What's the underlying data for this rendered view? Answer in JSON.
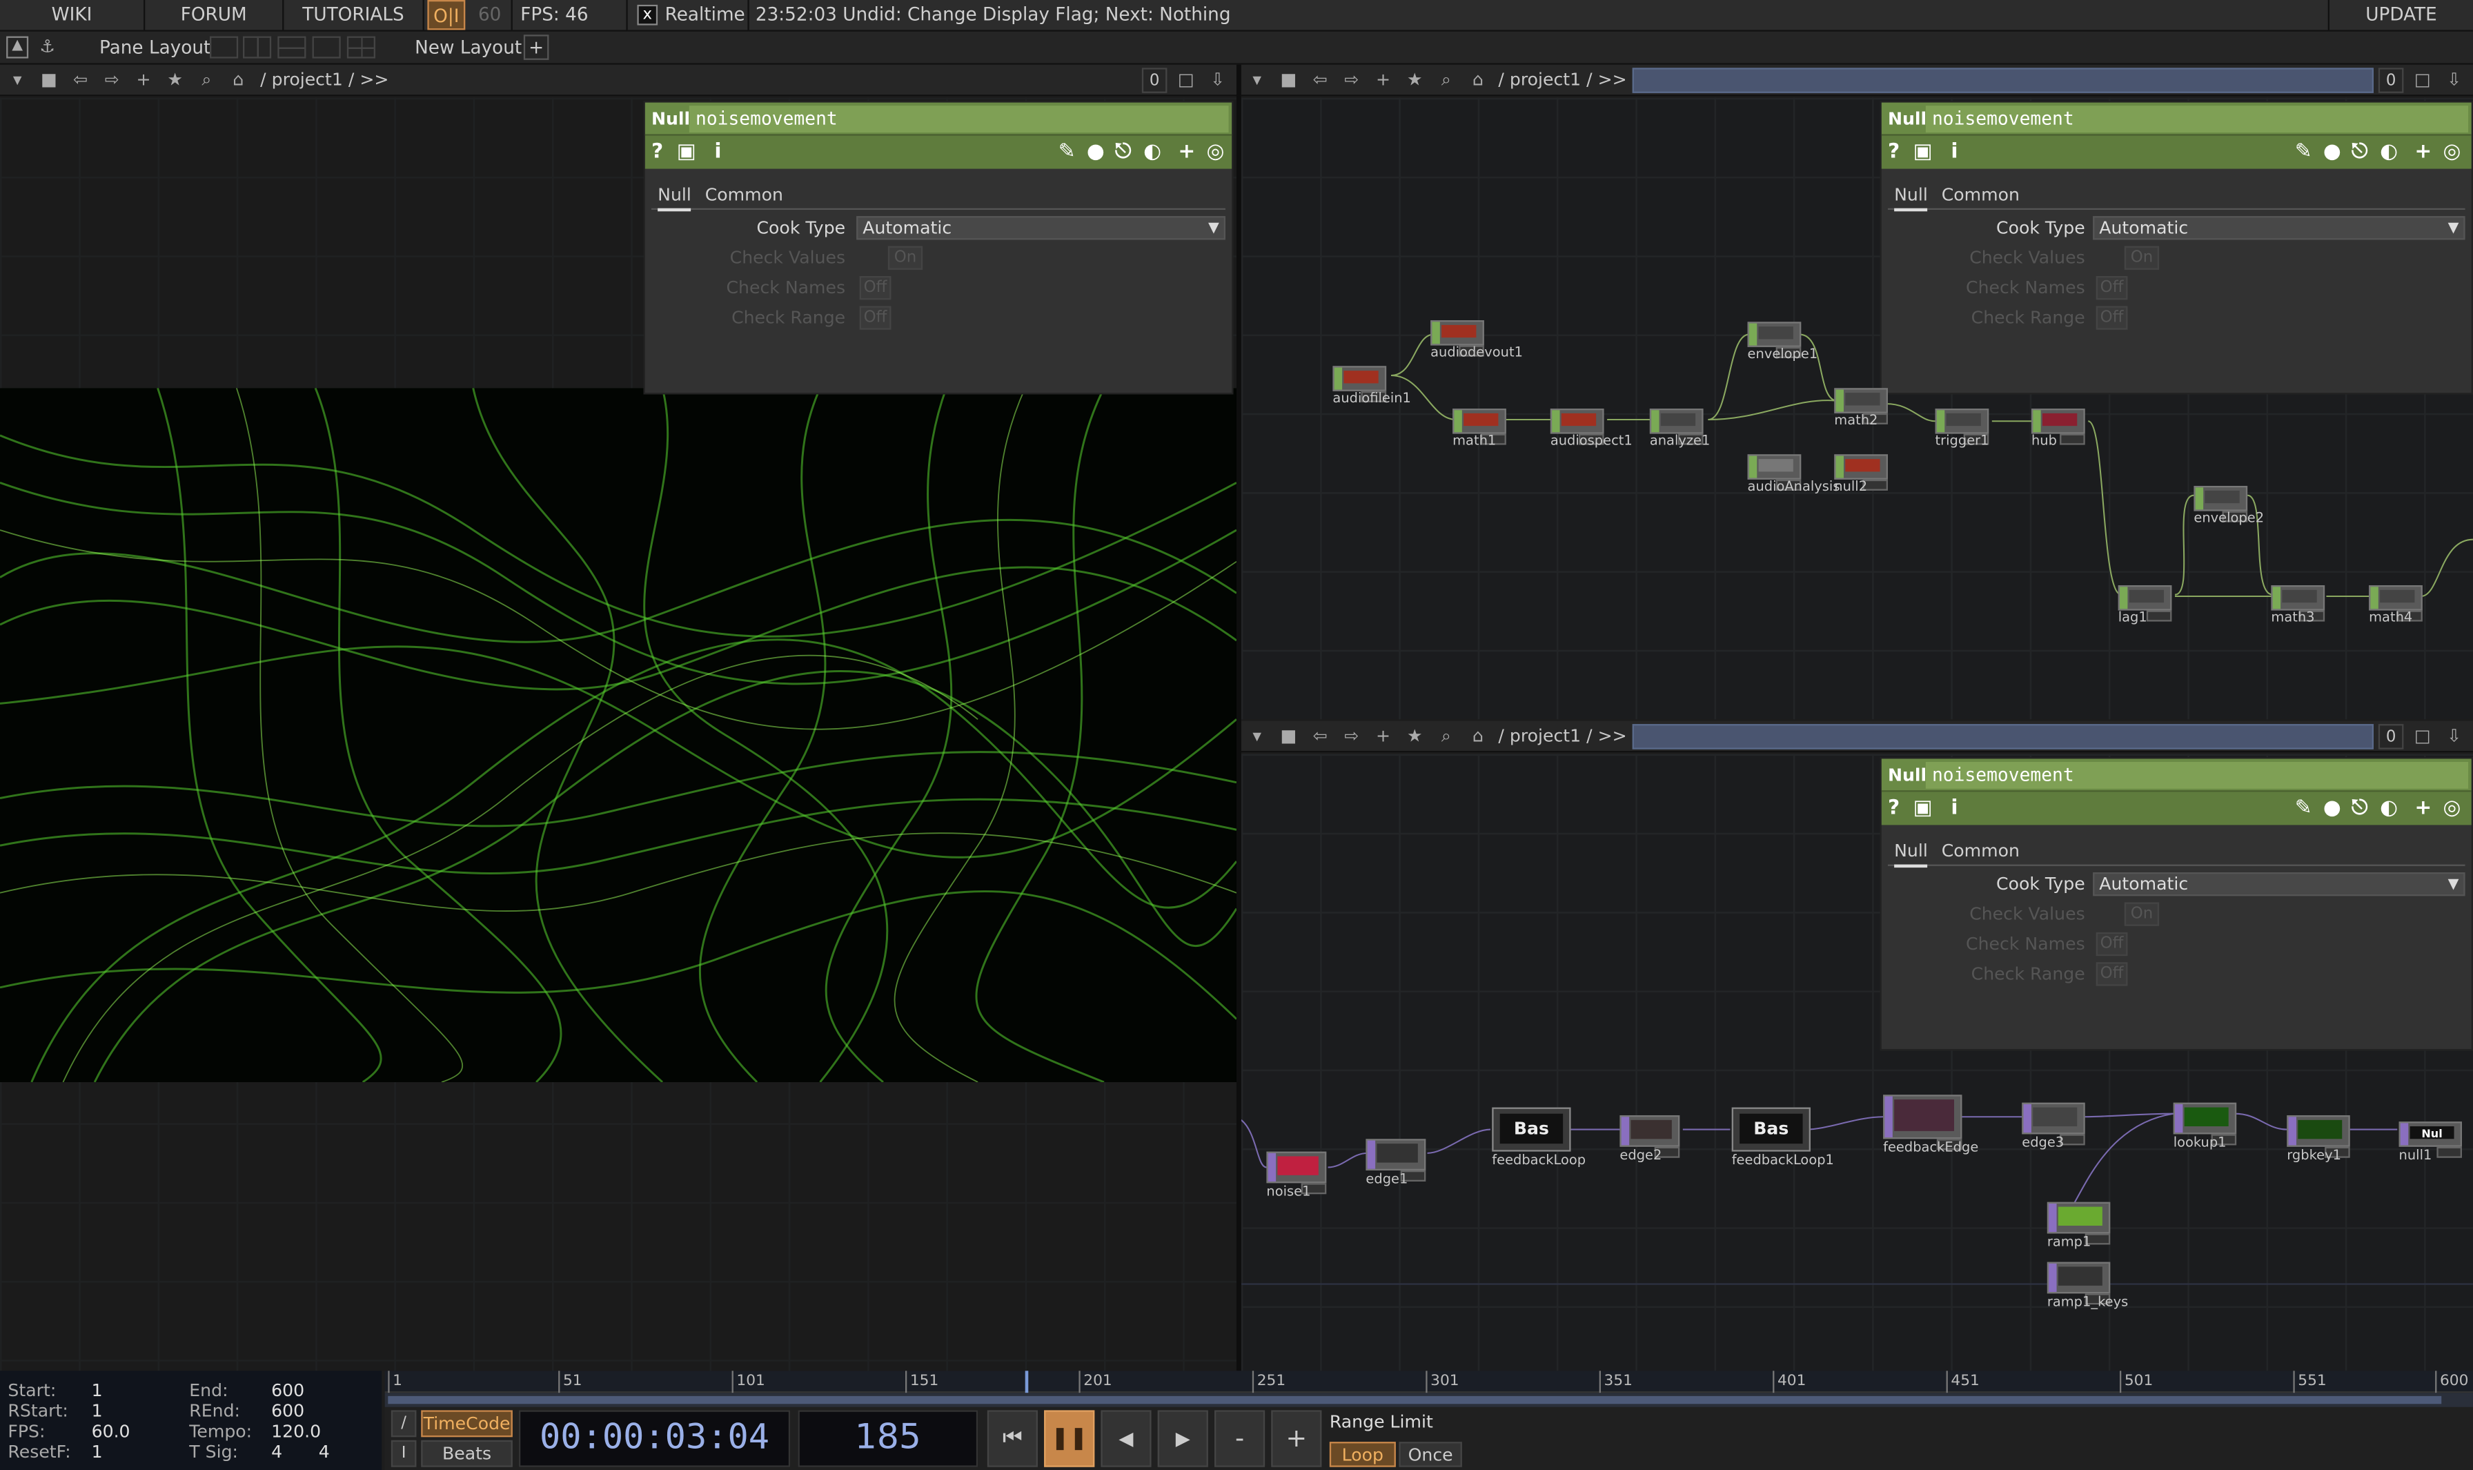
{
  "topbar": {
    "wiki": "WIKI",
    "forum": "FORUM",
    "tutorials": "TUTORIALS",
    "oi": "O|I",
    "fps_cap": "60",
    "fps": "FPS:  46",
    "realtime_check": "x",
    "realtime": "Realtime",
    "undo": "23:52:03 Undid: Change Display Flag; Next: Nothing",
    "update": "UPDATE"
  },
  "layoutbar": {
    "pane_layout": "Pane Layout",
    "new_layout": "New Layout",
    "plus": "+"
  },
  "pane": {
    "path": "/ project1 / >>",
    "zero": "0"
  },
  "param": {
    "type": "Null",
    "name": "noisemovement",
    "tab_null": "Null",
    "tab_common": "Common",
    "cook_type_label": "Cook Type",
    "cook_type_value": "Automatic",
    "check_values_label": "Check Values",
    "check_values": "On",
    "check_names_label": "Check Names",
    "check_names": "Off",
    "check_range_label": "Check Range",
    "check_range": "Off"
  },
  "audio_nodes": [
    "audiofilein1",
    "audiodevout1",
    "math1",
    "audiospect1",
    "analyze1",
    "envelope1",
    "math2",
    "audioAnalysis",
    "null2",
    "trigger1",
    "hub",
    "envelope2",
    "lag1",
    "math3",
    "math4"
  ],
  "tex_nodes": {
    "noise1": "noise1",
    "edge1": "edge1",
    "feedbackLoop": "feedbackLoop",
    "edge2": "edge2",
    "feedbackLoop1": "feedbackLoop1",
    "feedbackEdge": "feedbackEdge",
    "edge3": "edge3",
    "lookup1": "lookup1",
    "rgbkey1": "rgbkey1",
    "null1": "null1",
    "ramp1": "ramp1",
    "ramp1_keys": "ramp1_keys",
    "bas": "Bas",
    "nul": "Nul"
  },
  "stats": {
    "start_k": "Start:",
    "start_v": "1",
    "rstart_k": "RStart:",
    "rstart_v": "1",
    "fps_k": "FPS:",
    "fps_v": "60.0",
    "resetf_k": "ResetF:",
    "resetf_v": "1",
    "end_k": "End:",
    "end_v": "600",
    "rend_k": "REnd:",
    "rend_v": "600",
    "tempo_k": "Tempo:",
    "tempo_v": "120.0",
    "tsig_k": "T Sig:",
    "tsig_v1": "4",
    "tsig_v2": "4"
  },
  "ruler": [
    "1",
    "51",
    "101",
    "151",
    "201",
    "251",
    "301",
    "351",
    "401",
    "451",
    "501",
    "551",
    "600"
  ],
  "transport": {
    "slash": "/",
    "i": "I",
    "timecode": "TimeCode",
    "beats": "Beats",
    "time": "00:00:03:04",
    "frame": "185",
    "minus": "-",
    "plus": "+",
    "range_limit": "Range Limit",
    "loop": "Loop",
    "once": "Once"
  },
  "colors": {
    "accent_green": "#6a8a45",
    "timecode_orange": "#c8874a",
    "time_blue": "#9ab0e8"
  }
}
